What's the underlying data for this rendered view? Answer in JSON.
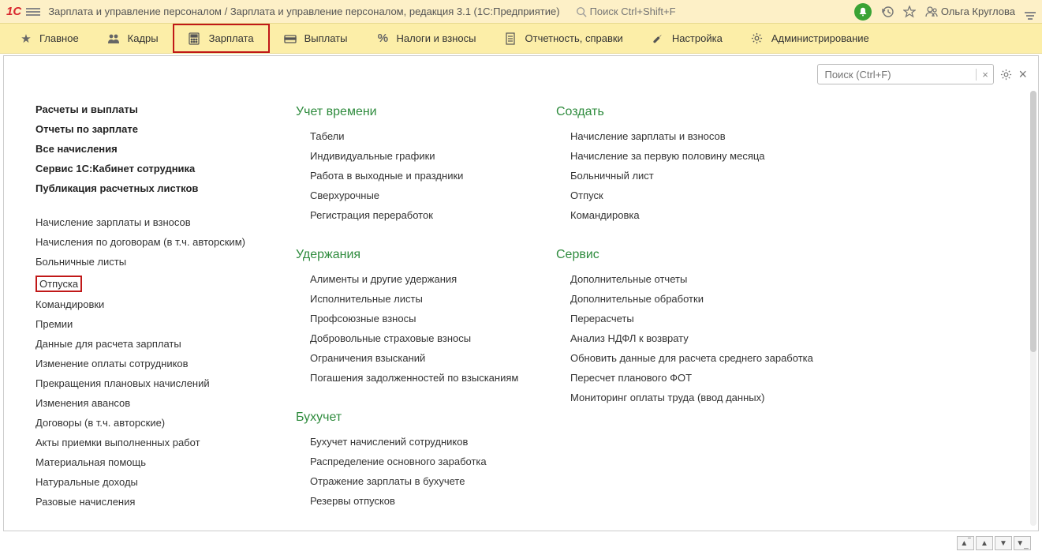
{
  "titlebar": {
    "app_title": "Зарплата и управление персоналом / Зарплата и управление персоналом, редакция 3.1  (1С:Предприятие)",
    "search_placeholder": "Поиск Ctrl+Shift+F",
    "user_name": "Ольга Круглова"
  },
  "nav": [
    {
      "label": "Главное"
    },
    {
      "label": "Кадры"
    },
    {
      "label": "Зарплата"
    },
    {
      "label": "Выплаты"
    },
    {
      "label": "Налоги и взносы"
    },
    {
      "label": "Отчетность, справки"
    },
    {
      "label": "Настройка"
    },
    {
      "label": "Администрирование"
    }
  ],
  "content_search": {
    "placeholder": "Поиск (Ctrl+F)",
    "clear": "×"
  },
  "left_bold": [
    "Расчеты и выплаты",
    "Отчеты по зарплате",
    "Все начисления",
    "Сервис 1С:Кабинет сотрудника",
    "Публикация расчетных листков"
  ],
  "left_plain": [
    "Начисление зарплаты и взносов",
    "Начисления по договорам (в т.ч. авторским)",
    "Больничные листы",
    "Отпуска",
    "Командировки",
    "Премии",
    "Данные для расчета зарплаты",
    "Изменение оплаты сотрудников",
    "Прекращения плановых начислений",
    "Изменения авансов",
    "Договоры (в т.ч. авторские)",
    "Акты приемки выполненных работ",
    "Материальная помощь",
    "Натуральные доходы",
    "Разовые начисления"
  ],
  "sections_mid": [
    {
      "head": "Учет времени",
      "items": [
        "Табели",
        "Индивидуальные графики",
        "Работа в выходные и праздники",
        "Сверхурочные",
        "Регистрация переработок"
      ]
    },
    {
      "head": "Удержания",
      "items": [
        "Алименты и другие удержания",
        "Исполнительные листы",
        "Профсоюзные взносы",
        "Добровольные страховые взносы",
        "Ограничения взысканий",
        "Погашения задолженностей по взысканиям"
      ]
    },
    {
      "head": "Бухучет",
      "items": [
        "Бухучет начислений сотрудников",
        "Распределение основного заработка",
        "Отражение зарплаты в бухучете",
        "Резервы отпусков"
      ]
    }
  ],
  "sections_right": [
    {
      "head": "Создать",
      "items": [
        "Начисление зарплаты и взносов",
        "Начисление за первую половину месяца",
        "Больничный лист",
        "Отпуск",
        "Командировка"
      ]
    },
    {
      "head": "Сервис",
      "items": [
        "Дополнительные отчеты",
        "Дополнительные обработки",
        "Перерасчеты",
        "Анализ НДФЛ к возврату",
        "Обновить данные для расчета среднего заработка",
        "Пересчет планового ФОТ",
        "Мониторинг оплаты труда (ввод данных)"
      ]
    }
  ]
}
